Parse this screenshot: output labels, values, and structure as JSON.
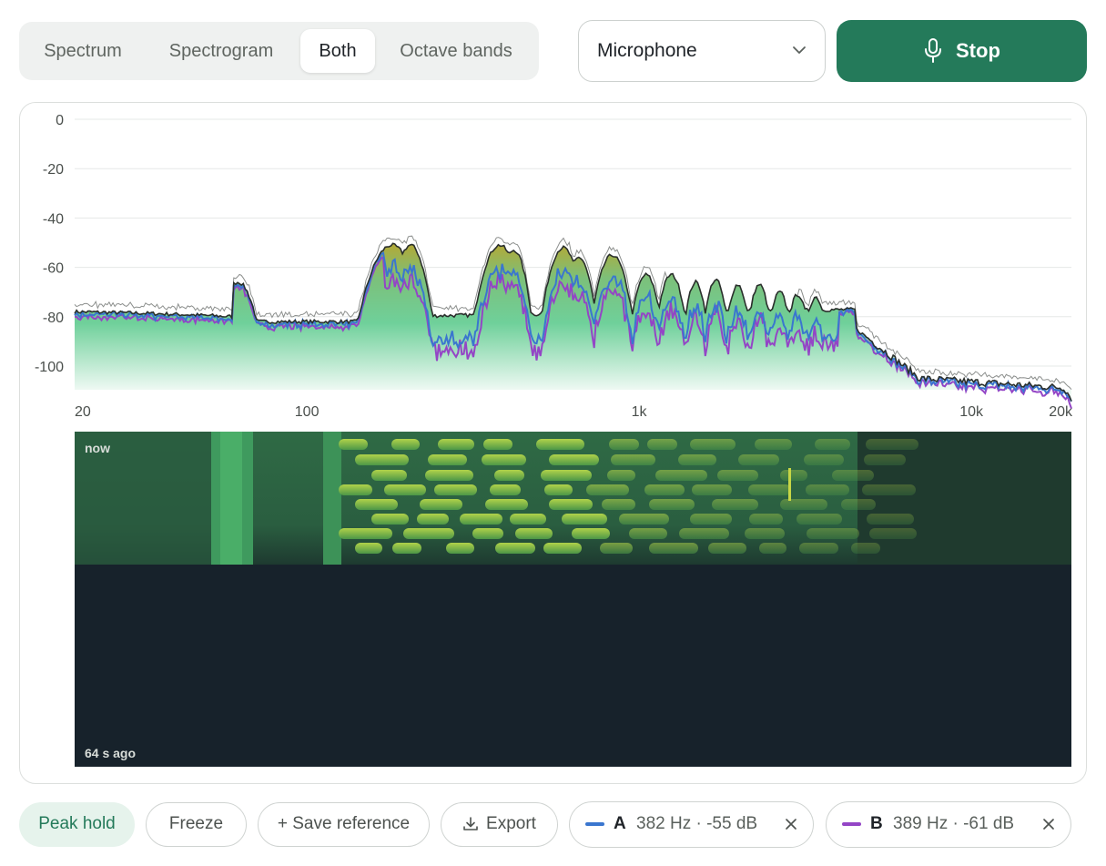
{
  "view_tabs": [
    {
      "label": "Spectrum",
      "active": false
    },
    {
      "label": "Spectrogram",
      "active": false
    },
    {
      "label": "Both",
      "active": true
    },
    {
      "label": "Octave bands",
      "active": false
    }
  ],
  "source_select": {
    "value": "Microphone"
  },
  "stop_button": {
    "label": "Stop",
    "icon": "microphone-icon",
    "color": "#247a5a"
  },
  "spectrum": {
    "y_ticks": [
      "0",
      "-20",
      "-40",
      "-60",
      "-80",
      "-100"
    ],
    "x_ticks": [
      "20",
      "100",
      "1k",
      "10k",
      "20k"
    ],
    "colors": {
      "live": "#2a2f2c",
      "trace_a": "#3a76cf",
      "trace_b": "#9445c6",
      "reference": "#8c8f8d",
      "fill_low": "#e8f7ef",
      "fill_high": "#b5a830"
    }
  },
  "spectrogram": {
    "top_label": "now",
    "bottom_label": "64 s ago"
  },
  "controls": {
    "peak_hold": "Peak hold",
    "freeze": "Freeze",
    "save_reference": "+ Save reference",
    "export": "Export"
  },
  "markers": [
    {
      "key": "A",
      "value": "382 Hz · -55 dB",
      "color": "#3a76cf"
    },
    {
      "key": "B",
      "value": "389 Hz · -61 dB",
      "color": "#9445c6"
    }
  ]
}
